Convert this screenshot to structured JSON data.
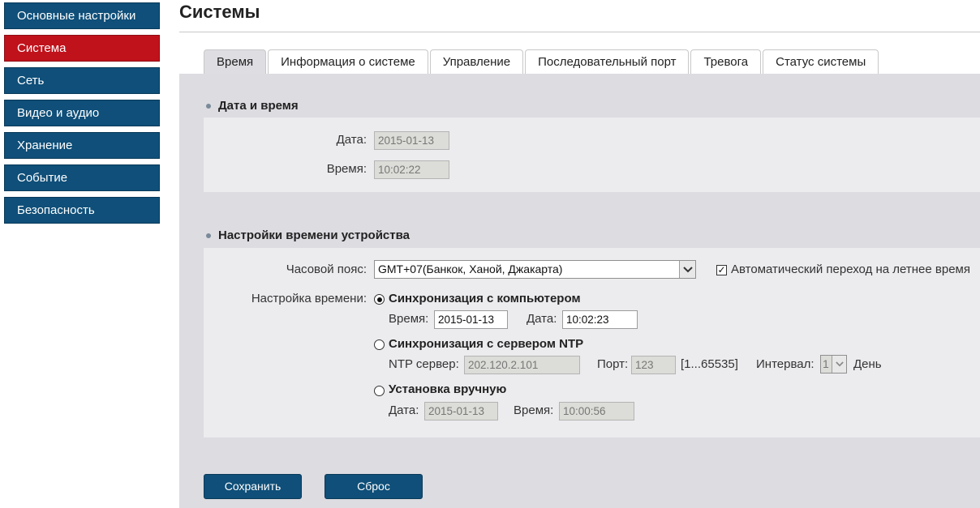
{
  "sidebar": {
    "items": [
      {
        "label": "Основные настройки"
      },
      {
        "label": "Система"
      },
      {
        "label": "Сеть"
      },
      {
        "label": "Видео и аудио"
      },
      {
        "label": "Хранение"
      },
      {
        "label": "Событие"
      },
      {
        "label": "Безопасность"
      }
    ]
  },
  "page": {
    "title": "Системы"
  },
  "tabs": [
    {
      "label": "Время"
    },
    {
      "label": "Информация о системе"
    },
    {
      "label": "Управление"
    },
    {
      "label": "Последовательный порт"
    },
    {
      "label": "Тревога"
    },
    {
      "label": "Статус системы"
    }
  ],
  "datetime": {
    "heading": "Дата и время",
    "date_label": "Дата:",
    "date_value": "2015-01-13",
    "time_label": "Время:",
    "time_value": "10:02:22"
  },
  "device_time": {
    "heading": "Настройки времени устройства",
    "timezone_label": "Часовой пояс:",
    "timezone_value": "GMT+07(Банкок, Ханой, Джакарта)",
    "dst_label": "Автоматический переход на летнее время",
    "dst_checked": true,
    "time_setting_label": "Настройка времени:",
    "sync_pc": {
      "title": "Синхронизация с компьютером",
      "time_label": "Время:",
      "time_value": "2015-01-13",
      "date_label": "Дата:",
      "date_value": "10:02:23"
    },
    "sync_ntp": {
      "title": "Синхронизация с сервером NTP",
      "server_label": "NTP сервер:",
      "server_value": "202.120.2.101",
      "port_label": "Порт:",
      "port_value": "123",
      "port_range": "[1...65535]",
      "interval_label": "Интервал:",
      "interval_value": "1",
      "interval_unit": "День"
    },
    "manual": {
      "title": "Установка вручную",
      "date_label": "Дата:",
      "date_value": "2015-01-13",
      "time_label": "Время:",
      "time_value": "10:00:56"
    }
  },
  "buttons": {
    "save": "Сохранить",
    "reset": "Сброс"
  },
  "colors": {
    "nav": "#0f4f79",
    "nav_active": "#c0121b",
    "content_bg": "#dcdce1",
    "panel_bg": "#ececef"
  }
}
